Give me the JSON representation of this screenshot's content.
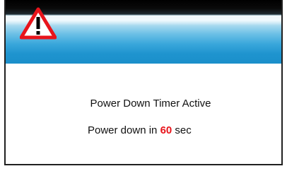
{
  "dialog": {
    "icon": "warning-triangle-icon",
    "title": "Power Down Timer Active",
    "countdown_prefix": "Power down in",
    "countdown_value": "60",
    "countdown_unit": "sec"
  },
  "colors": {
    "header_blue": "#1b8fca",
    "warning_red": "#e8141b",
    "text": "#111111"
  }
}
